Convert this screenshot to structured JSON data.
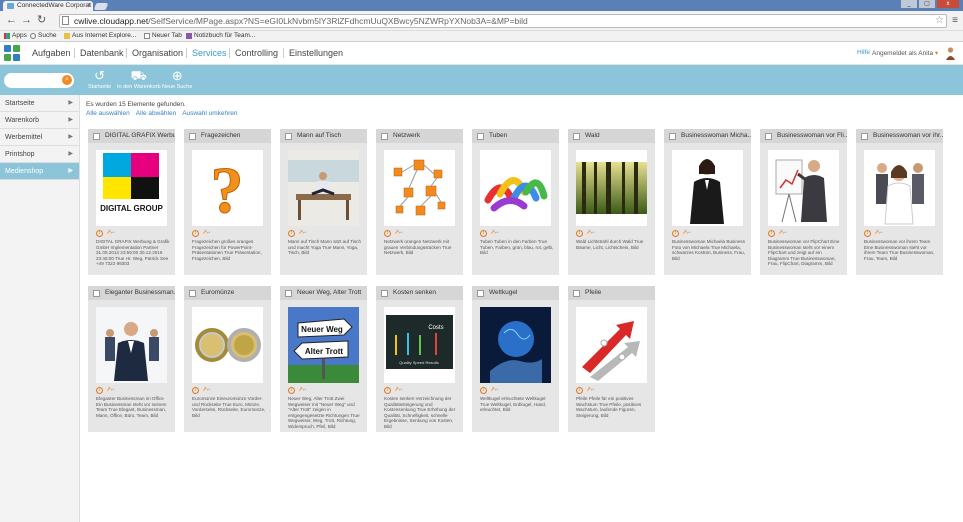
{
  "browser": {
    "tab_title": "ConnectedWare Corporat",
    "url_host": "cwlive.cloudapp.net",
    "url_path": "/SelfService/MPage.aspx?NS=eGI0LkNvbm5lY3RlZFdhcmUuQXBwcy5NZWRpYXNob3A=&MP=bild",
    "window_controls": [
      "_",
      "▢",
      "x"
    ]
  },
  "bookmarks": [
    {
      "label": "Apps",
      "icon": "apps-grid-icon"
    },
    {
      "label": "Suche",
      "icon": "search-icon"
    },
    {
      "label": "Aus Internet Explore...",
      "icon": "folder-icon"
    },
    {
      "label": "Neuer Tab",
      "icon": "page-icon"
    },
    {
      "label": "Notizbuch für Team...",
      "icon": "notebook-icon"
    }
  ],
  "appnav": {
    "items": [
      "Aufgaben",
      "Datenbank",
      "Organisation",
      "Services",
      "Controlling",
      "Einstellungen"
    ],
    "active": "Services",
    "help": "Hilfe",
    "logged_in": "Angemeldet als Anita"
  },
  "toolbar": {
    "tools": [
      {
        "label": "Startseite",
        "icon": "undo-arrow-icon",
        "glyph": "↺"
      },
      {
        "label": "In den Warenkorb",
        "icon": "basket-icon",
        "glyph": "⛟"
      },
      {
        "label": "Neue Suche",
        "icon": "magnifier-plus-icon",
        "glyph": "⊕"
      }
    ]
  },
  "sidebar": {
    "items": [
      "Startseite",
      "Warenkorb",
      "Werbemittel",
      "Printshop",
      "Medienshop"
    ],
    "active": "Medienshop"
  },
  "content": {
    "found_text": "Es wurden 15 Elemente gefunden.",
    "links": [
      "Alle auswählen",
      "Alle abwählen",
      "Auswahl umkehren"
    ]
  },
  "cards": [
    {
      "title": "DIGITAL GRAFIX Werbu...",
      "thumb": "digital-group-logo",
      "desc": "DIGITAL GRAFIX Werbung & Grafik GmbH Implementation Partner 31.05.2013 23:59:00 30.12.2016 23:45:00 True Hr. Weg, Patrick See +49 7322 99303"
    },
    {
      "title": "Fragezeichen",
      "thumb": "question-mark",
      "desc": "Fragezeichen großes oranges Fragezeichen für PowerPoint-Präsentationen True Präsentation, Fragezeichen, Bild"
    },
    {
      "title": "Mann auf Tisch",
      "thumb": "man-on-desk",
      "desc": "Mann auf Tisch Mann sitzt auf Tisch und macht Yoga True Mann, Yoga, Tisch, Bild"
    },
    {
      "title": "Netzwerk",
      "thumb": "network-cubes",
      "desc": "Netzwerk orangen Netzwerk mit grauen Verbindungsstücken True Netzwerk, Bild"
    },
    {
      "title": "Tuben",
      "thumb": "color-tubes",
      "desc": "Tuben Tuben in den Farben True Tuben, Farben, grün, blau, rot, gelb, Bild"
    },
    {
      "title": "Wald",
      "thumb": "forest",
      "desc": "Wald Lichtstrahl durch Wald True Bäume, Licht, Lichtschein, Bild"
    },
    {
      "title": "Businesswoman Micha...",
      "thumb": "businesswoman-1",
      "desc": "Businesswoman Michaela Business Foto von Michaela True Michaela, schwarzes Kostüm, Business, Frau, Bild"
    },
    {
      "title": "Businesswoman vor Fli...",
      "thumb": "businesswoman-flipchart",
      "desc": "Businesswoman vor FlipChart Eine Businesswoman steht vor einem FlipChart und zeigt auf ein Diagramm True Businesswoman, Frau, FlipChart, Diagramm, Bild"
    },
    {
      "title": "Businesswoman vor ihr...",
      "thumb": "businesswoman-team",
      "desc": "Businesswoman vor ihrem Team Eine Businesswoman steht vor ihrem Team True Businesswoman, Frau, Team, Bild"
    },
    {
      "title": "Eleganter Businessman...",
      "thumb": "businessman-office",
      "desc": "Eleganter Businessman im Office Ein Businessman steht vor seinem Team True Elegant, Businessman, Mann, Office, Büro, Team, Bild"
    },
    {
      "title": "Euromünze",
      "thumb": "euro-coins",
      "desc": "Euromünze Eineuromünze Vorder- und Rückseite True Euro, Münze, Vorderseite, Rückseite, Euromünze, Bild"
    },
    {
      "title": "Neuer Weg, Alter Trott",
      "thumb": "road-signs",
      "desc": "Neuer Weg, Alter Trott Zwei Wegweiser mit \"Neuer Weg\" und \"Alter Trott\" zeigen in entgegengesetzte Richtungen True Wegweiser, Weg, Trott, Richtung, Widerspruch, Pfeil, Bild"
    },
    {
      "title": "Kosten senken",
      "thumb": "cost-chalkboard",
      "desc": "Kosten senken Verzeichnung der Qualitätssteigerung und Kostensenkung True Erhöhung der Qualität, Schnelligkeit, schnelle Ergebnisse, Senkung von Kosten, Bild"
    },
    {
      "title": "Weltkugel",
      "thumb": "globe-hand",
      "desc": "Weltkugel erleuchtete Weltkugel True Weltkugel, Erdkugel, Hand, erleuchtet, Bild"
    },
    {
      "title": "Pfeile",
      "thumb": "red-arrows",
      "desc": "Pfeile Pfeile für ein positives Wachstum True Pfeile, positives Wachstum, laufende Figuren, Steigerung, Bild"
    }
  ],
  "colors": {
    "accent": "#3a9ad0",
    "band": "#8cc4da",
    "orange": "#e47a1d",
    "chrome_titlebar": "#5b7fb7"
  }
}
